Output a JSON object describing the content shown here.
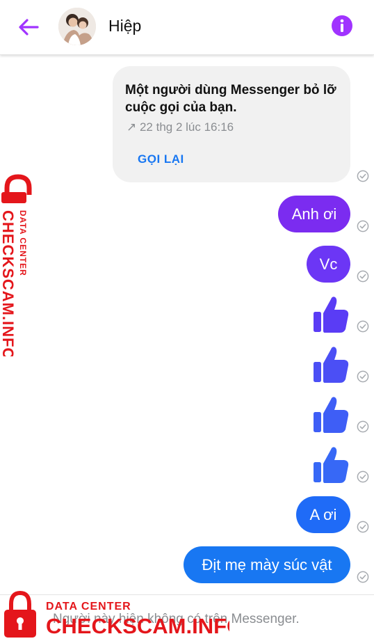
{
  "header": {
    "contact_name": "Hiệp",
    "back_icon": "arrow-left-icon",
    "info_icon": "info-icon"
  },
  "call_card": {
    "title": "Một người dùng Messenger bỏ lỡ cuộc gọi của bạn.",
    "time": "↗ 22 thg 2 lúc 16:16",
    "call_back_label": "GỌI LẠI"
  },
  "messages": [
    {
      "type": "text",
      "text": "Anh ơi",
      "color": "#7b2cf0"
    },
    {
      "type": "text",
      "text": "Vc",
      "color": "#6c36f5"
    },
    {
      "type": "like",
      "icon": "thumbs-up-icon",
      "color": "#5a3cf5"
    },
    {
      "type": "like",
      "icon": "thumbs-up-icon",
      "color": "#4b4ff5"
    },
    {
      "type": "like",
      "icon": "thumbs-up-icon",
      "color": "#3e5ef6"
    },
    {
      "type": "like",
      "icon": "thumbs-up-icon",
      "color": "#3768f6"
    },
    {
      "type": "text",
      "text": "A ơi",
      "color": "#1f6bf7"
    },
    {
      "type": "text",
      "text": "Địt mẹ mày súc vật",
      "color": "#1877f2"
    }
  ],
  "footer": {
    "notice": "Người này hiện không có trên Messenger."
  },
  "watermark": {
    "line1": "DATA CENTER",
    "line2": "CHECKSCAM.INFO",
    "color": "#e4161b"
  },
  "colors": {
    "accent": "#a033ff",
    "link": "#1877f2",
    "card_bg": "#f1f1f1"
  }
}
